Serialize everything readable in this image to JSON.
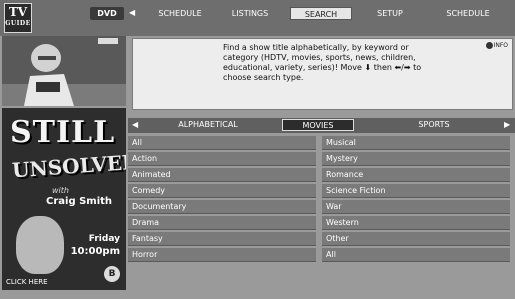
{
  "logo": {
    "line1": "TV",
    "line2": "GUIDE"
  },
  "topnav": {
    "source": "DVD",
    "left_arrow": "◀",
    "tabs": [
      {
        "label": "SCHEDULE"
      },
      {
        "label": "LISTINGS"
      },
      {
        "label": "SEARCH"
      },
      {
        "label": "SETUP"
      },
      {
        "label": "SCHEDULE"
      }
    ],
    "active_tab": "SEARCH"
  },
  "promo": {
    "title_line1": "STILL",
    "title_line2": "UNSOLVED",
    "with": "with",
    "host": "Craig Smith",
    "day": "Friday",
    "time": "10:00pm",
    "badge": "B",
    "click_label": "CLICK HERE"
  },
  "info": {
    "button_label": "INFO",
    "text": "Find a show title alphabetically, by keyword or category (HDTV, movies, sports, news, children, educational, variety, series)! Move ⬇ then ⬅/➡ to choose search type."
  },
  "categories": {
    "left_arrow": "◀",
    "right_arrow": "▶",
    "tabs": [
      {
        "label": "ALPHABETICAL"
      },
      {
        "label": "MOVIES"
      },
      {
        "label": "SPORTS"
      }
    ],
    "active_tab": "MOVIES"
  },
  "genres": {
    "left": [
      "All",
      "Action",
      "Animated",
      "Comedy",
      "Documentary",
      "Drama",
      "Fantasy",
      "Horror"
    ],
    "right": [
      "Musical",
      "Mystery",
      "Romance",
      "Science Fiction",
      "War",
      "Western",
      "Other",
      "All"
    ]
  }
}
